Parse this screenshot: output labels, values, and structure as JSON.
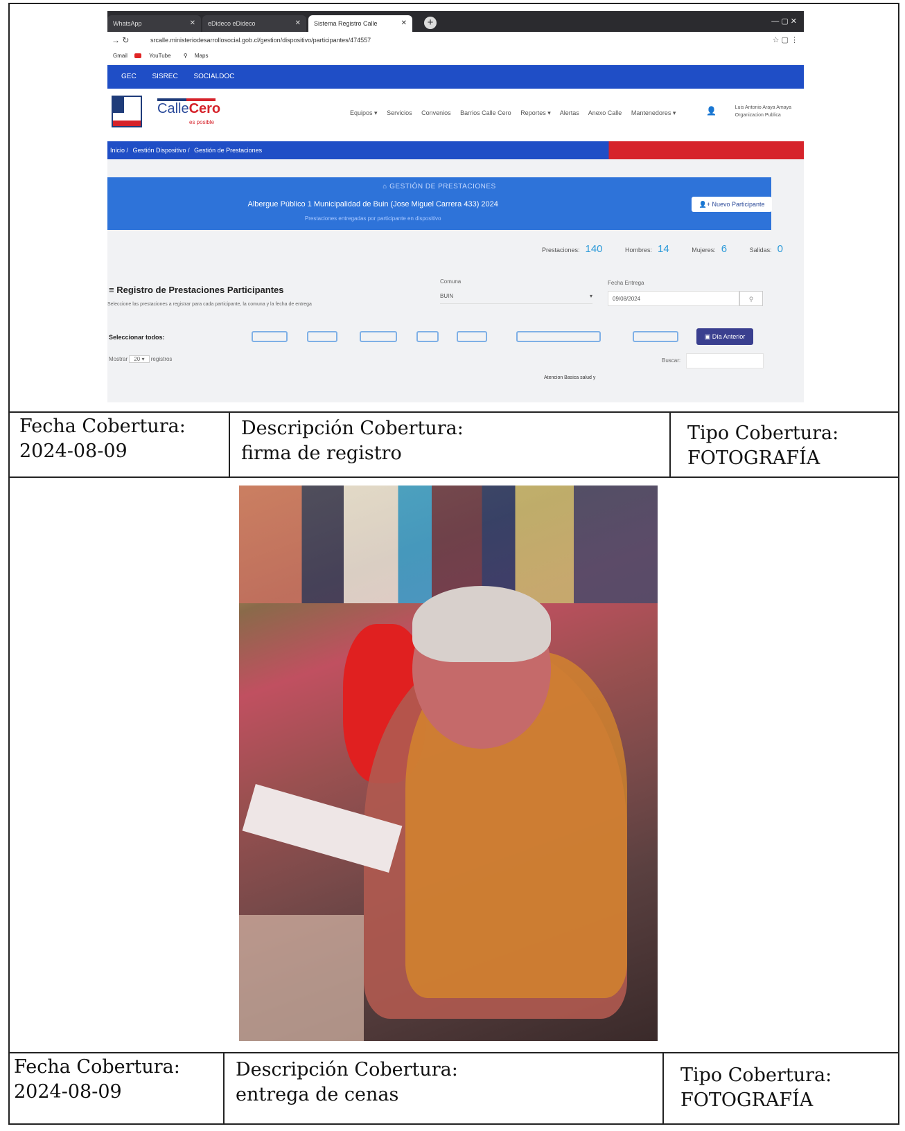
{
  "captions": [
    {
      "fecha_label": "Fecha Cobertura:",
      "fecha_value": "2024-08-09",
      "descripcion_label": "Descripción Cobertura:",
      "descripcion_value": "firma de registro",
      "tipo_label": "Tipo Cobertura:",
      "tipo_value": "FOTOGRAFÍA"
    },
    {
      "fecha_label": "Fecha Cobertura:",
      "fecha_value": "2024-08-09",
      "descripcion_label": "Descripción Cobertura:",
      "descripcion_value": "entrega de cenas",
      "tipo_label": "Tipo Cobertura:",
      "tipo_value": "FOTOGRAFÍA"
    }
  ],
  "screenshot": {
    "tabs": [
      "WhatsApp",
      "eDideco eDideco",
      "Sistema Registro Calle"
    ],
    "url": "srcalle.ministeriodesarrollosocial.gob.cl/gestion/dispositivo/participantes/474557",
    "bookmarks": [
      "Gmail",
      "YouTube",
      "Maps"
    ],
    "top_links": [
      "GEC",
      "SISREC",
      "SOCIALDOC"
    ],
    "brand": {
      "part1": "Calle",
      "part2": "Cero",
      "sub": "es posible"
    },
    "menu": [
      "Equipos ▾",
      "Servicios",
      "Convenios",
      "Barrios Calle Cero",
      "Reportes ▾",
      "Alertas",
      "Anexo Calle",
      "Mantenedores ▾"
    ],
    "user": {
      "name": "Luis Antonio Araya Amaya",
      "org": "Organizacion Publica"
    },
    "breadcrumb": [
      "Inicio",
      "Gestión Dispositivo",
      "Gestión de Prestaciones"
    ],
    "panel": {
      "heading": "GESTIÓN DE PRESTACIONES",
      "title": "Albergue Público 1 Municipalidad de Buin (Jose Miguel Carrera 433) 2024",
      "subtitle": "Prestaciones entregadas por participante en dispositivo"
    },
    "new_participant": "Nuevo Participante",
    "stats": [
      {
        "label": "Prestaciones:",
        "value": "140"
      },
      {
        "label": "Hombres:",
        "value": "14"
      },
      {
        "label": "Mujeres:",
        "value": "6"
      },
      {
        "label": "Salidas:",
        "value": "0"
      }
    ],
    "registro_title": "Registro de Prestaciones Participantes",
    "registro_help": "Seleccione las prestaciones a registrar para cada participante, la comuna y la fecha de entrega",
    "comuna_label": "Comuna",
    "comuna_value": "BUIN",
    "fecha_label": "Fecha Entrega",
    "fecha_value": "09/08/2024",
    "select_all": "Seleccionar todos:",
    "dia_anterior": "Día Anterior",
    "mostrar": "Mostrar",
    "mostrar_value": "20",
    "registros": "registros",
    "buscar": "Buscar:",
    "atencion": "Atencion Basica salud y"
  },
  "colors": {
    "brand_blue": "#1f4ec6",
    "brand_red": "#d6232b",
    "panel_blue": "#2e73d9"
  }
}
